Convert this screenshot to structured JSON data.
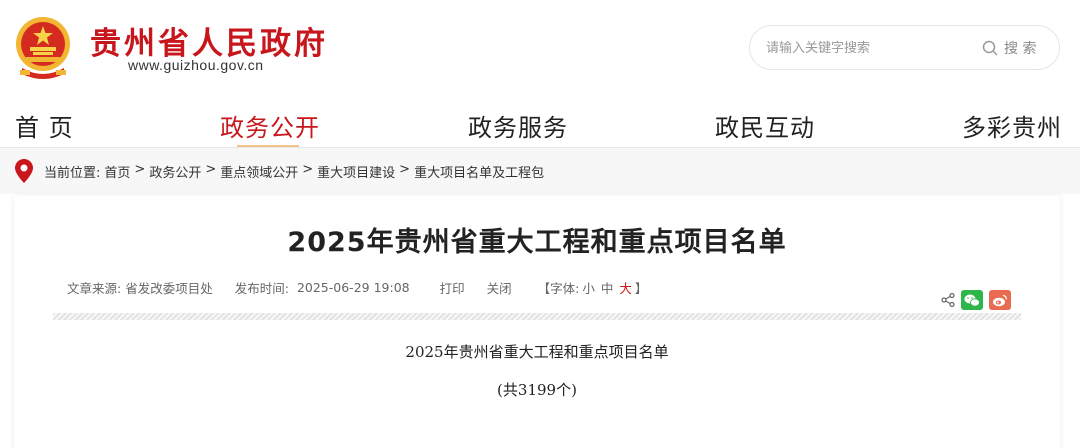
{
  "header": {
    "site_title": "贵州省人民政府",
    "site_url": "www.guizhou.gov.cn",
    "search_placeholder": "请输入关键字搜索",
    "search_label": "搜 索",
    "emblem_icon": "national-emblem-icon",
    "brand_color": "#c8161d"
  },
  "nav": {
    "items": [
      {
        "label": "首 页"
      },
      {
        "label": "政务公开"
      },
      {
        "label": "政务服务"
      },
      {
        "label": "政民互动"
      },
      {
        "label": "多彩贵州"
      }
    ],
    "active_index": 1
  },
  "breadcrumb": {
    "prefix": "当前位置:",
    "items": [
      "首页",
      "政务公开",
      "重点领域公开",
      "重大项目建设",
      "重大项目名单及工程包"
    ],
    "separator": ">"
  },
  "article": {
    "title": "2025年贵州省重大工程和重点项目名单",
    "source_label": "文章来源:",
    "source": "省发改委项目处",
    "date_label": "发布时间:",
    "date": "2025-06-29 19:08",
    "print": "打印",
    "close": "关闭",
    "font_open": "【字体:",
    "font_small": "小",
    "font_medium": "中",
    "font_large": "大",
    "font_close": "】",
    "body_title": "2025年贵州省重大工程和重点项目名单",
    "body_count": "(共3199个)"
  }
}
